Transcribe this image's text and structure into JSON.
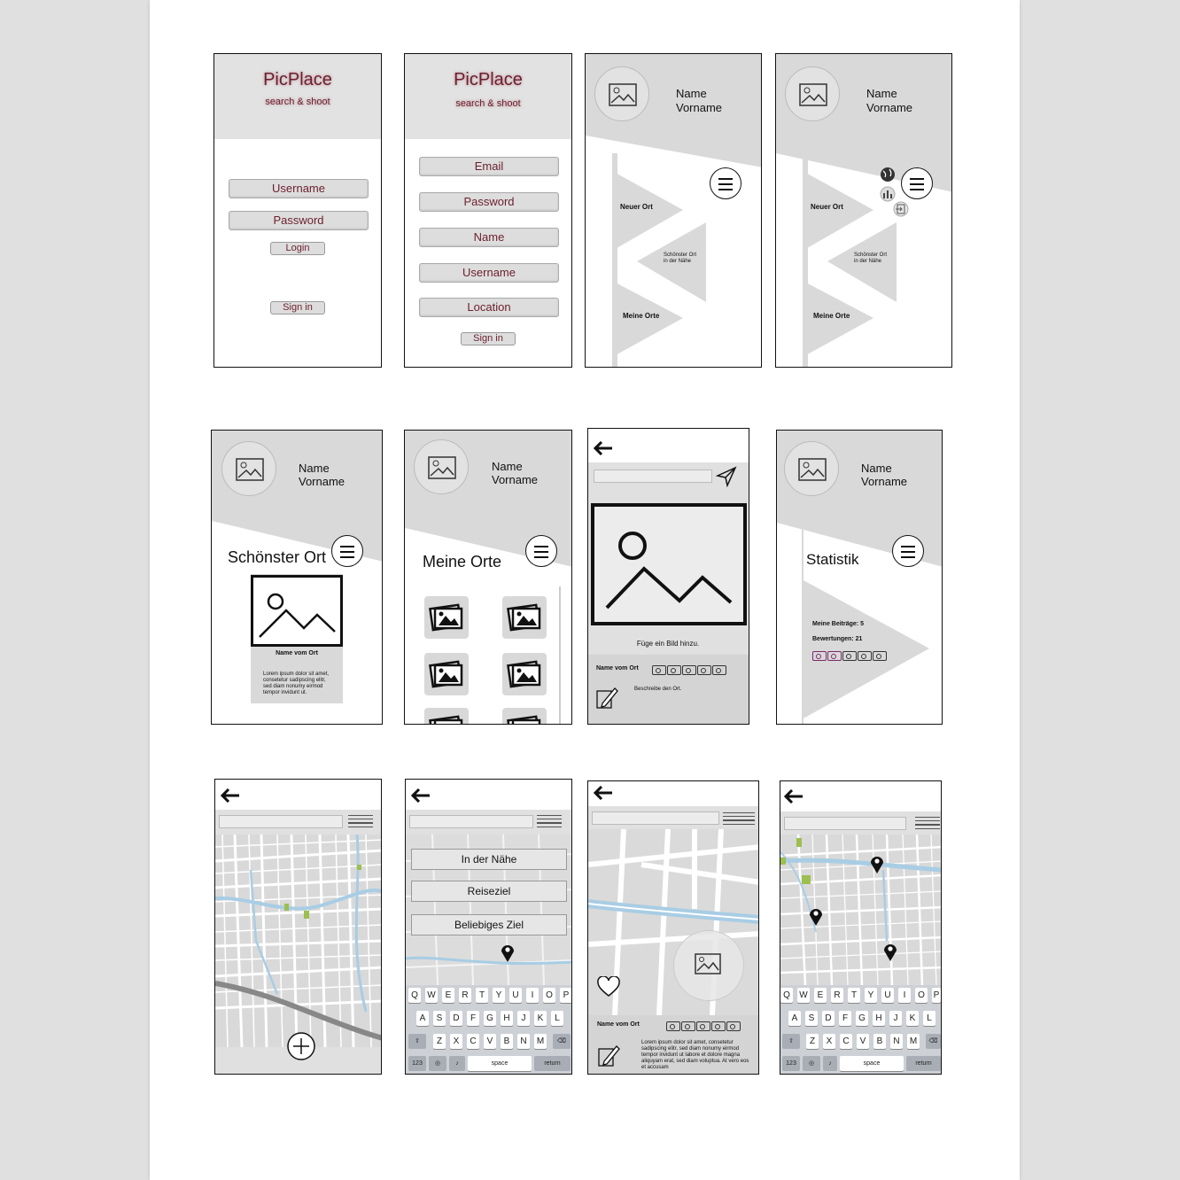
{
  "brand": {
    "name": "PicPlace",
    "tagline": "search & shoot"
  },
  "login": {
    "username": "Username",
    "password": "Password",
    "login": "Login",
    "signin": "Sign in"
  },
  "register": {
    "email": "Email",
    "password": "Password",
    "name": "Name",
    "username": "Username",
    "location": "Location",
    "signin": "Sign in"
  },
  "profile": {
    "name": "Name",
    "vorname": "Vorname"
  },
  "home": {
    "neuer_ort": "Neuer Ort",
    "schoenster_line1": "Schönster Ort",
    "schoenster_line2": "in der Nähe",
    "meine_orte": "Meine Orte"
  },
  "schoenster": {
    "title": "Schönster Ort",
    "place": "Name vom Ort",
    "lorem": [
      "Lorem ipsum dolor sit amet,",
      "consetetur sadipscing elitr,",
      "sed diam nonumy eirmod",
      "tempor invidunt ut."
    ]
  },
  "meine_orte": {
    "title": "Meine Orte"
  },
  "new_place": {
    "add_image": "Füge ein Bild hinzu.",
    "place": "Name vom Ort",
    "describe": "Beschreibe den Ort."
  },
  "statistik": {
    "title": "Statistik",
    "beitraege": "Meine Beiträge: 5",
    "bewertungen": "Bewertungen: 21"
  },
  "search_options": [
    "In der Nähe",
    "Reiseziel",
    "Beliebiges Ziel"
  ],
  "keyboard": {
    "row1": [
      "Q",
      "W",
      "E",
      "R",
      "T",
      "Y",
      "U",
      "I",
      "O",
      "P"
    ],
    "row2": [
      "A",
      "S",
      "D",
      "F",
      "G",
      "H",
      "J",
      "K",
      "L"
    ],
    "row3": [
      "Z",
      "X",
      "C",
      "V",
      "B",
      "N",
      "M"
    ],
    "num": "123",
    "space": "space",
    "ret": "return"
  },
  "detail": {
    "place": "Name vom Ort",
    "lorem": [
      "Lorem ipsum dolor sit amet, consetetur",
      "sadipscing elitr, sed diam nonumy eirmod",
      "tempor invidunt ut labore et dolore magna",
      "aliquyam erat, sed diam voluptua. At vero eos",
      "et accusam"
    ]
  },
  "colors": {
    "brand": "#6b1f2e",
    "rating": "#7a2a6a",
    "map_bg": "#d9d9d9",
    "map_water": "#a8cde4",
    "map_green": "#9cbf4f"
  }
}
